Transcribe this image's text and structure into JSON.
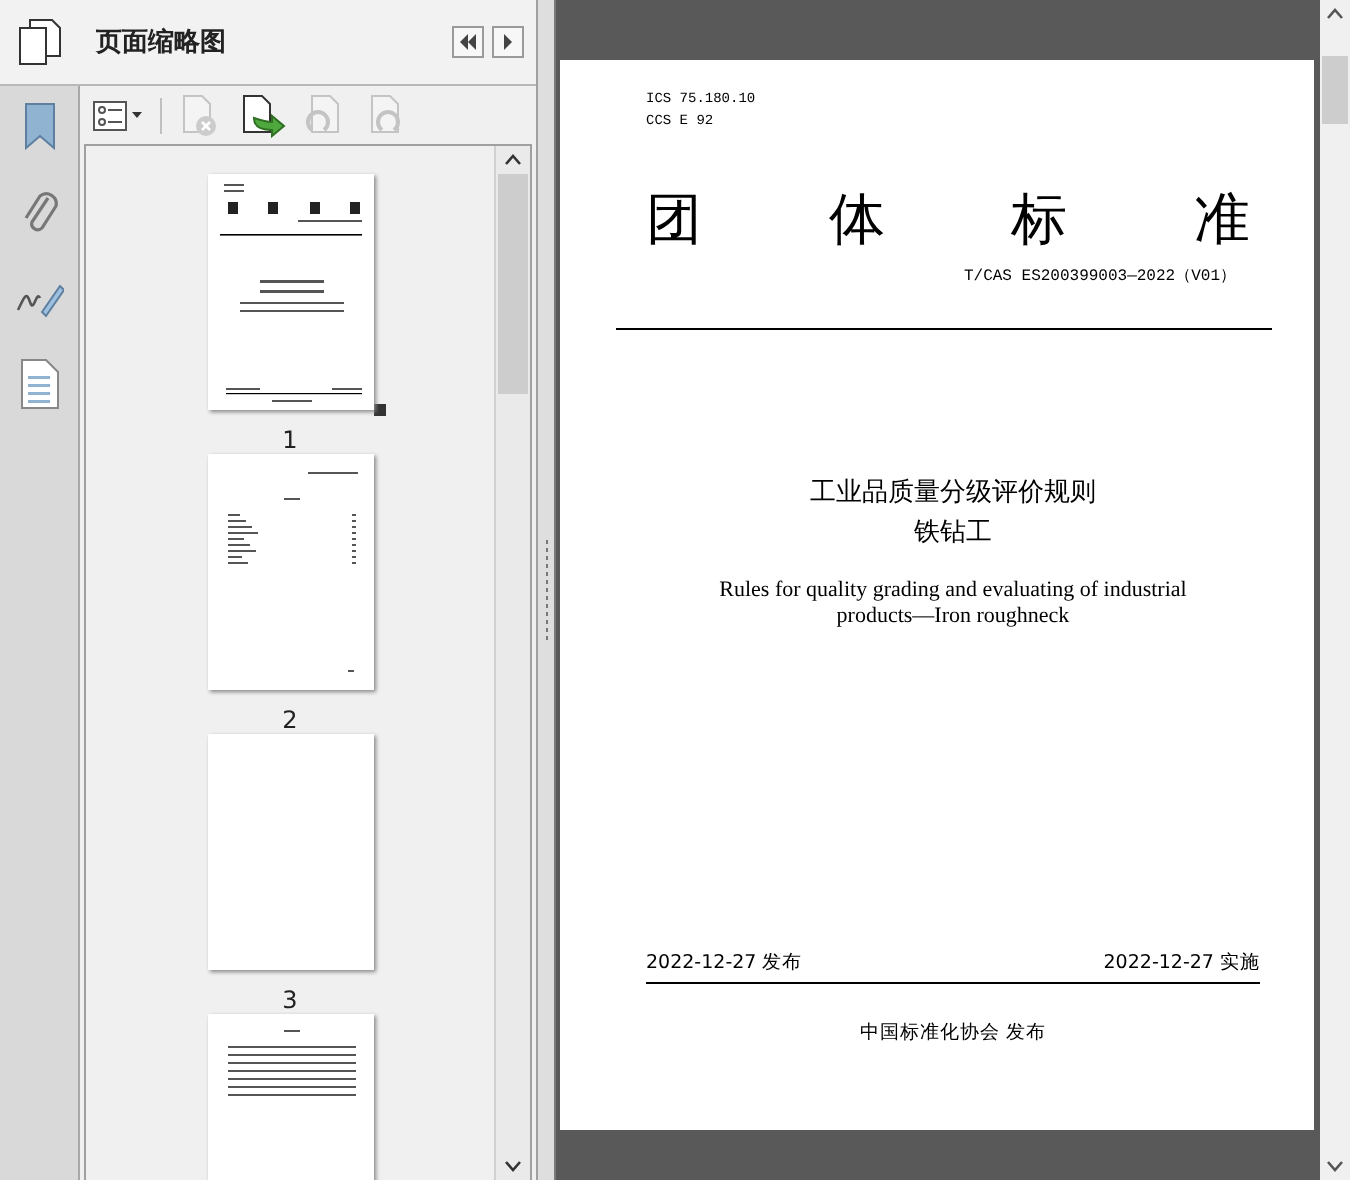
{
  "panel": {
    "title": "页面缩略图"
  },
  "thumbnails": [
    {
      "label": "1",
      "kind": "cover",
      "current": true
    },
    {
      "label": "2",
      "kind": "toc"
    },
    {
      "label": "3",
      "kind": "blank"
    },
    {
      "kind": "text"
    }
  ],
  "page": {
    "codes": [
      "ICS 75.180.10",
      "CCS E 92"
    ],
    "heading_chars": [
      "团",
      "体",
      "标",
      "准"
    ],
    "standard_number": "T/CAS ES200399003—2022（V01）",
    "title_lines": [
      "工业品质量分级评价规则",
      "铁钻工"
    ],
    "english_title_lines": [
      "Rules for quality grading and evaluating of industrial",
      "products—Iron roughneck"
    ],
    "issue_date": "2022-12-27 发布",
    "effective_date": "2022-12-27 实施",
    "publisher": "中国标准化协会 发布"
  }
}
